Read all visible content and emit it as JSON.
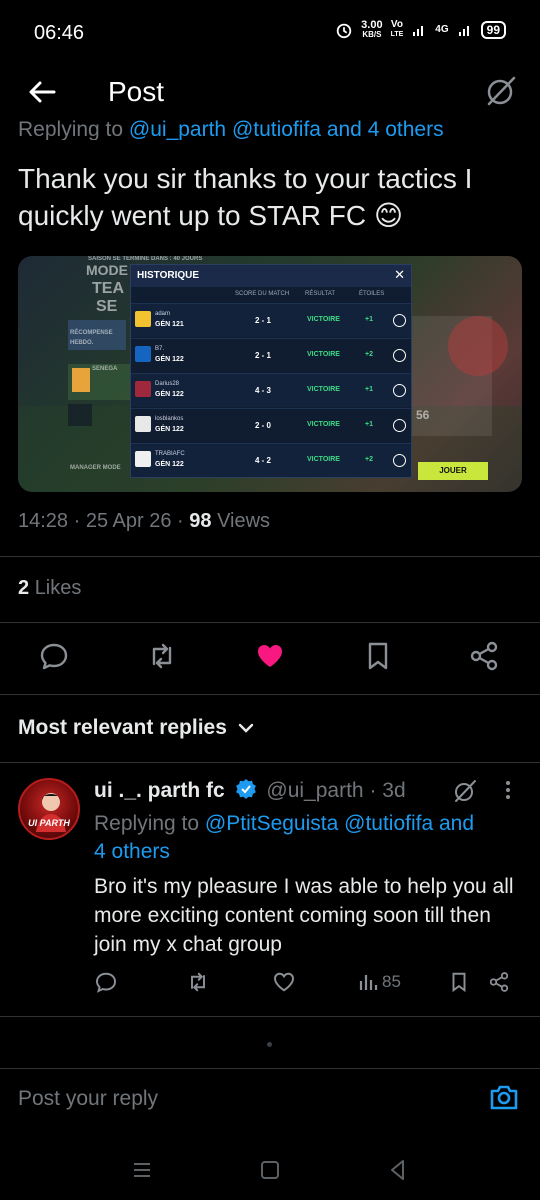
{
  "status_bar": {
    "time": "06:46",
    "speed_value": "3.00",
    "speed_unit": "KB/S",
    "net1": "Vo",
    "net1b": "LTE",
    "net2": "4G",
    "battery": "99"
  },
  "header": {
    "title": "Post"
  },
  "tweet": {
    "replying_prefix": "Replying to ",
    "replying_mentions": "@ui_parth @tutiofifa",
    "replying_suffix": " and 4 others",
    "text": "Thank you sir thanks to your tactics I quickly went up to STAR FC 😊",
    "time": "14:28",
    "date": "25 Apr 26",
    "views_count": "98",
    "views_label": "Views",
    "likes_count": "2",
    "likes_label": "Likes",
    "liked": true
  },
  "media": {
    "panel_title": "HISTORIQUE",
    "columns": [
      "SCORE DU MATCH",
      "RÉSULTAT",
      "ÉTOILES"
    ],
    "rows": [
      {
        "name": "adam",
        "gen": "GÉN 121",
        "score": "2 - 1",
        "result": "VICTOIRE",
        "stars": "+1",
        "badge_color": "#f2c230"
      },
      {
        "name": "B7.",
        "gen": "GÉN 122",
        "score": "2 - 1",
        "result": "VICTOIRE",
        "stars": "+2",
        "badge_color": "#1565c0"
      },
      {
        "name": "Darius28",
        "gen": "GÉN 122",
        "score": "4 - 3",
        "result": "VICTOIRE",
        "stars": "+1",
        "badge_color": "#a0283c"
      },
      {
        "name": "losblankos",
        "gen": "GÉN 122",
        "score": "2 - 0",
        "result": "VICTOIRE",
        "stars": "+1",
        "badge_color": "#e8e8e8"
      },
      {
        "name": "TRABIAFC",
        "gen": "GÉN 122",
        "score": "4 - 2",
        "result": "VICTOIRE",
        "stars": "+2",
        "badge_color": "#f0f0f0"
      }
    ],
    "bg_labels": {
      "top": "SAISON SE TERMINE DANS : 40 JOURS",
      "mode": "MODE",
      "team": "TEA",
      "se": "SE",
      "recompense": "RÉCOMPENSE",
      "hebdo": "HEBDO.",
      "senega": "SENEGA",
      "manager": "MANAGER MODE",
      "jouer": "JOUER",
      "num56": "56"
    }
  },
  "replies_sort_label": "Most relevant replies",
  "reply": {
    "avatar_text": "UI PARTH",
    "name": "ui ._. parth fc",
    "handle": "@ui_parth",
    "age": "3d",
    "replying_prefix": "Replying to ",
    "replying_mentions": "@PtitSeguista @tutiofifa",
    "replying_suffix_1": " and",
    "replying_suffix_2": "4 others",
    "text": "Bro it's my pleasure I was able to help you all more exciting content coming soon till then join  my x chat group",
    "views": "85"
  },
  "compose": {
    "placeholder": "Post your reply"
  },
  "colors": {
    "accent": "#1d9bf0",
    "like": "#f91880",
    "muted": "#71767b",
    "bg": "#000000"
  },
  "icons": {
    "back": "arrow-left-icon",
    "grok": "grok-icon",
    "reply": "comment-icon",
    "repost": "repost-icon",
    "like": "heart-icon",
    "bookmark": "bookmark-icon",
    "share": "share-icon",
    "camera": "camera-icon"
  }
}
